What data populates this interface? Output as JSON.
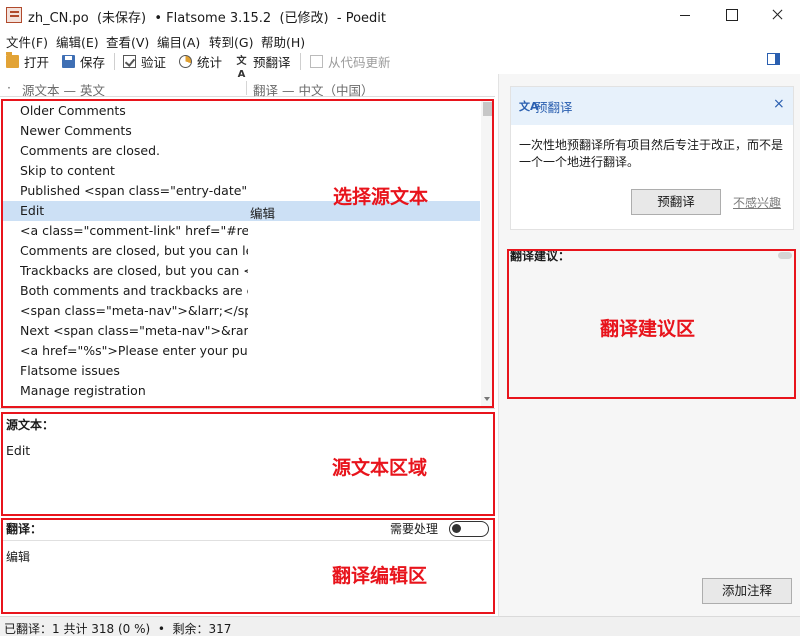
{
  "window": {
    "title": "zh_CN.po  (未保存)  • Flatsome 3.15.2  (已修改)  - Poedit"
  },
  "menu": [
    "文件(F)",
    "编辑(E)",
    "查看(V)",
    "编目(A)",
    "转到(G)",
    "帮助(H)"
  ],
  "toolbar": {
    "open": "打开",
    "save": "保存",
    "validate": "验证",
    "stats": "统计",
    "pretranslate": "预翻译",
    "update_from_code": "从代码更新"
  },
  "list": {
    "header_source": "源文本 — 英文",
    "header_translation": "翻译 — 中文（中国）",
    "rows": [
      {
        "source": "Older Comments",
        "translation": ""
      },
      {
        "source": "Newer Comments",
        "translation": ""
      },
      {
        "source": "Comments are closed.",
        "translation": ""
      },
      {
        "source": "Skip to content",
        "translation": ""
      },
      {
        "source": "Published <span class=\"entry-date\"...",
        "translation": ""
      },
      {
        "source": "Edit",
        "translation": "编辑"
      },
      {
        "source": "<a class=\"comment-link\" href=\"#res...",
        "translation": ""
      },
      {
        "source": "Comments are closed, but you can le...",
        "translation": ""
      },
      {
        "source": "Trackbacks are closed, but you can <...",
        "translation": ""
      },
      {
        "source": "Both comments and trackbacks are c...",
        "translation": ""
      },
      {
        "source": "<span class=\"meta-nav\">&larr;</sp...",
        "translation": ""
      },
      {
        "source": "Next <span class=\"meta-nav\">&rarr...",
        "translation": ""
      },
      {
        "source": "<a href=\"%s\">Please enter your pur...",
        "translation": ""
      },
      {
        "source": "Flatsome issues",
        "translation": ""
      },
      {
        "source": "Manage registration",
        "translation": ""
      }
    ]
  },
  "source_pane": {
    "label": "源文本：",
    "text": "Edit"
  },
  "translation_pane": {
    "label": "翻译：",
    "needs_work_label": "需要处理",
    "needs_work": false,
    "text": "编辑"
  },
  "sidebar": {
    "pretranslate_card": {
      "title": "预翻译",
      "close": "×",
      "description": "一次性地预翻译所有项目然后专注于改正，而不是一个一个地进行翻译。",
      "button": "预翻译",
      "dismiss": "不感兴趣"
    },
    "suggestions_label": "翻译建议：",
    "add_comment": "添加注释"
  },
  "status": {
    "text": "已翻译：1 共计 318 (0 %)  •  剩余：317"
  },
  "annotations": {
    "list": "选择源文本",
    "source": "源文本区域",
    "translation": "翻译编辑区",
    "suggestions": "翻译建议区",
    "color": "#e8141c"
  },
  "colors": {
    "selected_row": "#cce0f5",
    "accent": "#2a5fb0"
  }
}
